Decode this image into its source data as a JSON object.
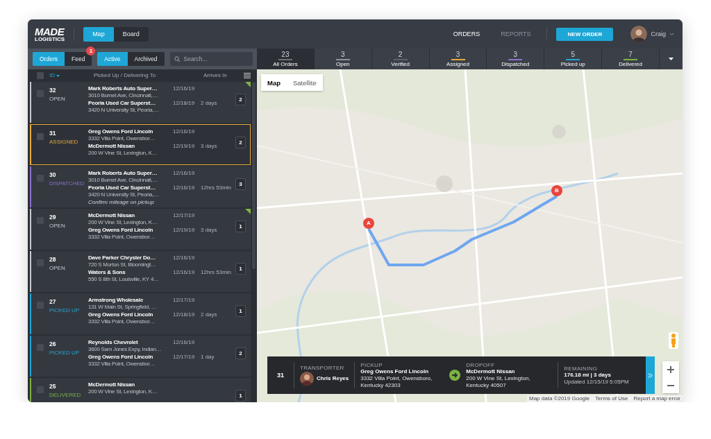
{
  "header": {
    "logo": {
      "line1": "MADE",
      "line2": "LOGISTICS"
    },
    "view_toggle": [
      {
        "label": "Map",
        "selected": true
      },
      {
        "label": "Board",
        "selected": false
      }
    ],
    "nav": [
      {
        "label": "ORDERS",
        "selected": true
      },
      {
        "label": "REPORTS",
        "selected": false
      }
    ],
    "new_order_button": "NEW ORDER",
    "user": {
      "name": "Craig"
    }
  },
  "panel_tabs": [
    {
      "label": "Orders",
      "selected": true
    },
    {
      "label": "Feed",
      "selected": false,
      "badge": "1"
    }
  ],
  "filter_tabs": [
    {
      "label": "Active",
      "selected": true
    },
    {
      "label": "Archived",
      "selected": false
    }
  ],
  "search": {
    "placeholder": "Search..."
  },
  "list": {
    "select_all": {
      "checked": false
    },
    "columns": [
      "ID",
      "Picked Up / Delivering To",
      "Arrives In"
    ],
    "rows": [
      {
        "id": "32",
        "status": "OPEN",
        "color": "#c5c9ce",
        "selected": false,
        "checked": false,
        "flagged": true,
        "stops": [
          {
            "name": "Mark Roberts Auto Super…",
            "address": "3010 Burnet Ave, Cincinnati,…",
            "date": "12/16/19"
          },
          {
            "name": "Peoria Used Car Superst…",
            "address": "3420 N University St, Peoria,…",
            "date": "12/18/19"
          }
        ],
        "arrives": "2 days",
        "count": "2"
      },
      {
        "id": "31",
        "status": "ASSIGNED",
        "color": "#e6a93a",
        "selected": true,
        "checked": false,
        "flagged": false,
        "stops": [
          {
            "name": "Greg Owens Ford Lincoln",
            "address": "3332 Villa Point, Owensbor…",
            "date": "12/16/19"
          },
          {
            "name": "McDermott Nissan",
            "address": "200 W Vine St, Lexington, K…",
            "date": "12/19/19"
          }
        ],
        "arrives": "3 days",
        "count": "2"
      },
      {
        "id": "30",
        "status": "DISPATCHED",
        "color": "#8b6fcc",
        "selected": false,
        "checked": false,
        "flagged": false,
        "stops": [
          {
            "name": "Mark Roberts Auto Super…",
            "address": "3010 Burnet Ave, Cincinnati,…",
            "date": "12/16/19"
          },
          {
            "name": "Peoria Used Car Superst…",
            "address": "3420 N University St, Peoria,…",
            "date": "12/16/19"
          }
        ],
        "note": "Confirm mileage on pickup",
        "arrives": "12hrs 53min",
        "count": "3"
      },
      {
        "id": "29",
        "status": "OPEN",
        "color": "#c5c9ce",
        "selected": false,
        "checked": false,
        "flagged": true,
        "stops": [
          {
            "name": "McDermott Nissan",
            "address": "200 W Vine St, Lexington, K…",
            "date": "12/17/19"
          },
          {
            "name": "Greg Owens Ford Lincoln",
            "address": "3332 Villa Point, Owensbor…",
            "date": "12/19/19"
          }
        ],
        "arrives": "3 days",
        "count": "1"
      },
      {
        "id": "28",
        "status": "OPEN",
        "color": "#c5c9ce",
        "selected": false,
        "checked": false,
        "flagged": false,
        "stops": [
          {
            "name": "Dave Parker Chrysler Do…",
            "address": "720 S Morton St, Bloomingt…",
            "date": "12/16/19"
          },
          {
            "name": "Waters & Sons",
            "address": "550 S 8th St, Louisville, KY 4…",
            "date": "12/16/19"
          }
        ],
        "arrives": "12hrs 53min",
        "count": "1"
      },
      {
        "id": "27",
        "status": "PICKED UP",
        "color": "#22a6d6",
        "selected": false,
        "checked": false,
        "flagged": false,
        "stops": [
          {
            "name": "Armstrong Wholesale",
            "address": "131 W Main St, Springfield, …",
            "date": "12/17/19"
          },
          {
            "name": "Greg Owens Ford Lincoln",
            "address": "3332 Villa Point, Owensbor…",
            "date": "12/18/19"
          }
        ],
        "arrives": "2 days",
        "count": "1"
      },
      {
        "id": "26",
        "status": "PICKED UP",
        "color": "#22a6d6",
        "selected": false,
        "checked": false,
        "flagged": false,
        "stops": [
          {
            "name": "Reynolds Chevrolet",
            "address": "3600 Sam Jones Expy, Indian…",
            "date": "12/16/19"
          },
          {
            "name": "Greg Owens Ford Lincoln",
            "address": "3332 Villa Point, Owensbor…",
            "date": "12/17/19"
          }
        ],
        "arrives": "1 day",
        "count": "2"
      },
      {
        "id": "25",
        "status": "DELIVERED",
        "color": "#7cb342",
        "selected": false,
        "checked": false,
        "flagged": false,
        "stops": [
          {
            "name": "McDermott Nissan",
            "address": "200 W Vine St, Lexington, K…"
          }
        ],
        "count": "1"
      }
    ]
  },
  "status_tabs": [
    {
      "count": "23",
      "label": "All Orders",
      "selected": true,
      "color": "#6c717a"
    },
    {
      "count": "3",
      "label": "Open",
      "selected": false,
      "color": "#8d9299"
    },
    {
      "count": "2",
      "label": "Verified",
      "selected": false,
      "color": "#5d626a"
    },
    {
      "count": "3",
      "label": "Assigned",
      "selected": false,
      "color": "#e6a93a"
    },
    {
      "count": "3",
      "label": "Dispatched",
      "selected": false,
      "color": "#8b6fcc"
    },
    {
      "count": "5",
      "label": "Picked up",
      "selected": false,
      "color": "#22a6d6"
    },
    {
      "count": "7",
      "label": "Delivered",
      "selected": false,
      "color": "#7cb342"
    }
  ],
  "map": {
    "kind": "picture",
    "type_toggle": [
      {
        "label": "Map",
        "selected": true
      },
      {
        "label": "Satellite",
        "selected": false
      }
    ],
    "markers": [
      {
        "label": "A"
      },
      {
        "label": "B"
      }
    ],
    "attribution": [
      "Map data ©2019 Google",
      "Terms of Use",
      "Report a map error"
    ]
  },
  "trip": {
    "id": "31",
    "transporter": {
      "label": "TRANSPORTER",
      "name": "Chris Reyes"
    },
    "pickup": {
      "label": "PICKUP",
      "name": "Greg Owens Ford Lincoln",
      "address": "3332 Villa Point, Owensboro, Kentucky 42303"
    },
    "dropoff": {
      "label": "DROPOFF",
      "name": "McDermott Nissan",
      "address": "200 W Vine St, Lexington, Kentucky 40507"
    },
    "remaining": {
      "label": "REMAINING",
      "value": "176.18 mi | 3 days",
      "updated": "Updated 12/15/19 5:05PM"
    }
  }
}
